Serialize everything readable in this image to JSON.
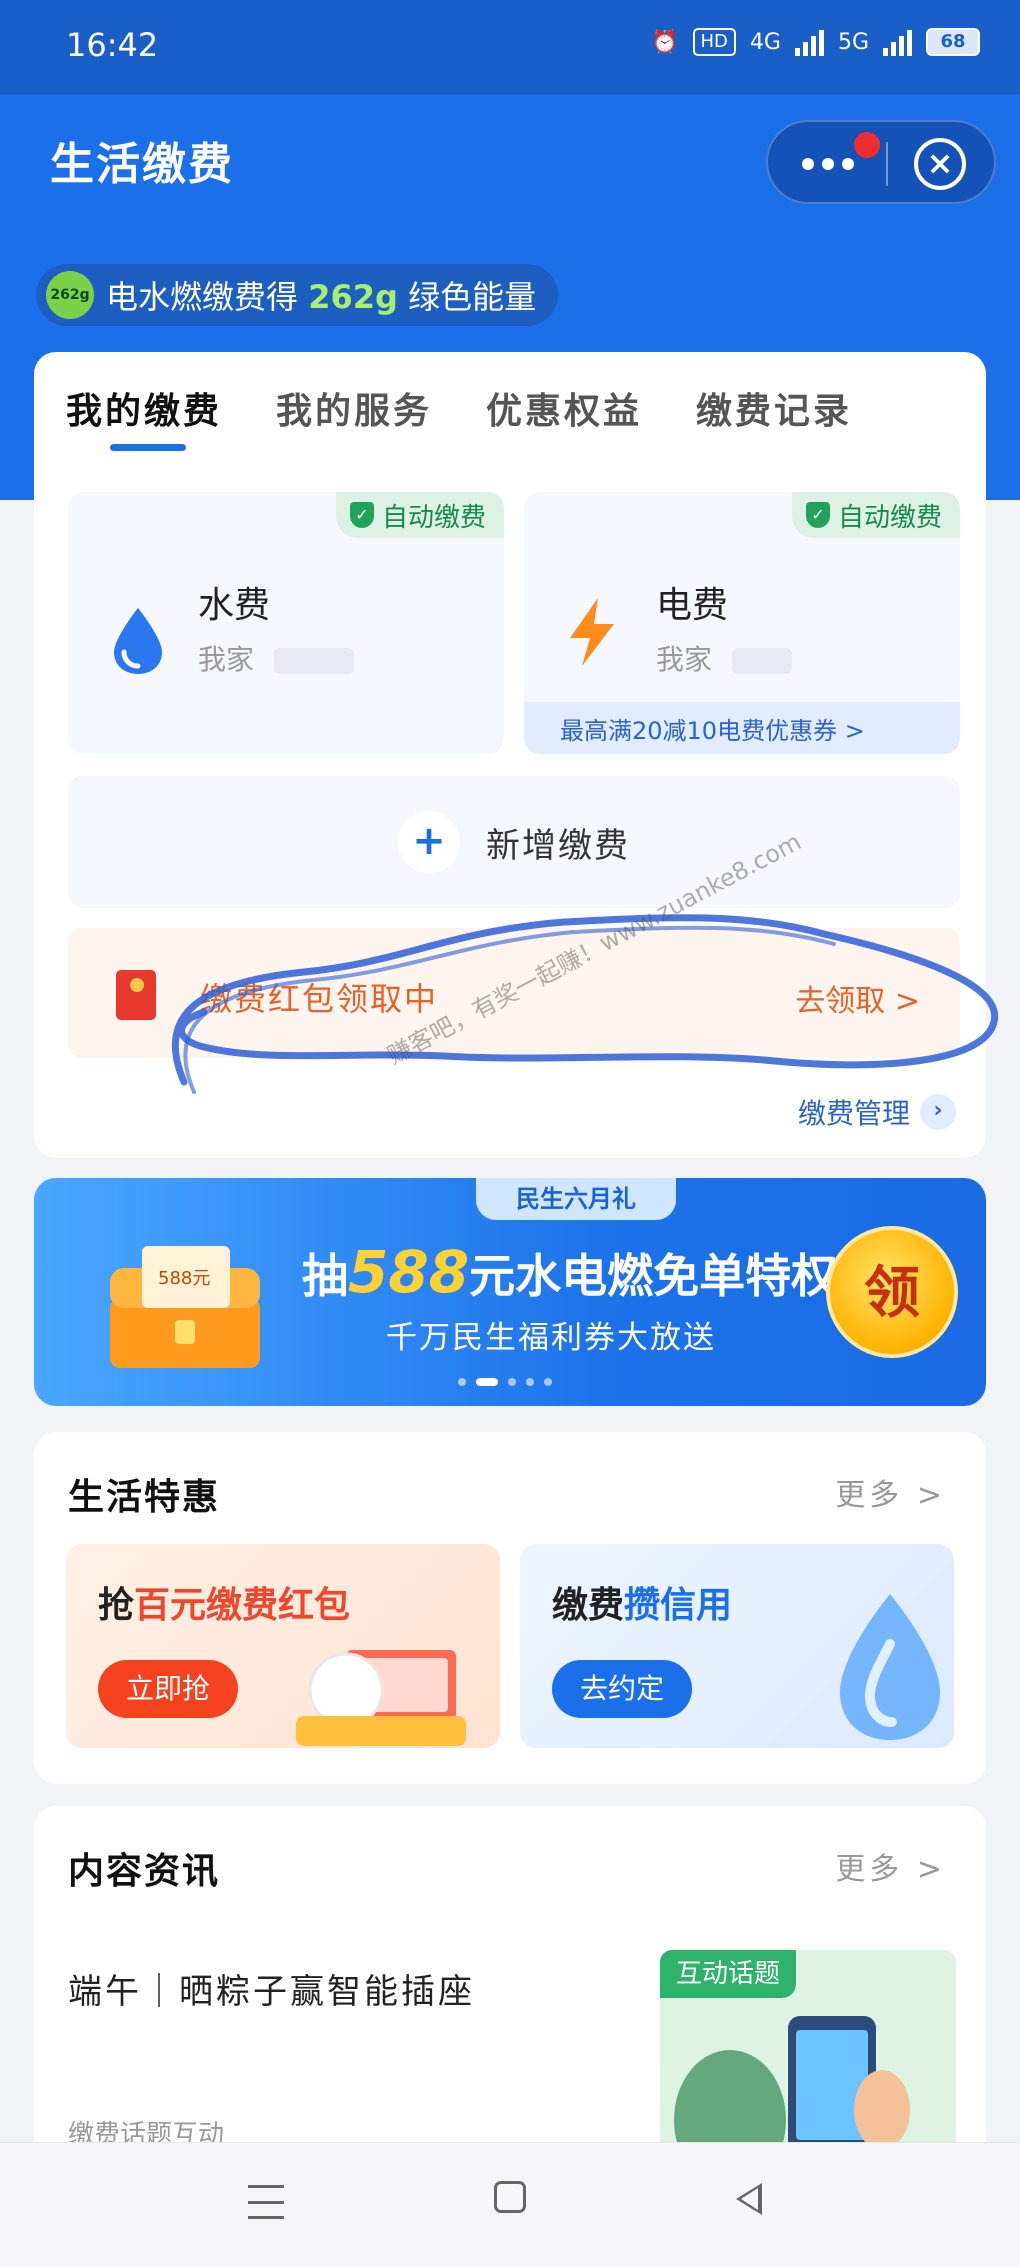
{
  "status_bar": {
    "time": "16:42",
    "hd": "HD",
    "net1": "4G",
    "net2": "5G",
    "battery": "68"
  },
  "header": {
    "title": "生活缴费",
    "menu_icon": "more-dots-icon",
    "close_icon": "close-circle-icon"
  },
  "energy": {
    "badge": "262g",
    "text_prefix": "电水燃缴费得",
    "amount": "262g",
    "text_suffix": "绿色能量"
  },
  "tabs": [
    {
      "label": "我的缴费",
      "active": true
    },
    {
      "label": "我的服务",
      "active": false
    },
    {
      "label": "优惠权益",
      "active": false
    },
    {
      "label": "缴费记录",
      "active": false
    }
  ],
  "bills": [
    {
      "name": "水费",
      "account": "我家",
      "auto_label": "自动缴费",
      "icon": "water-drop-icon"
    },
    {
      "name": "电费",
      "account": "我家",
      "auto_label": "自动缴费",
      "icon": "lightning-icon",
      "coupon": "最高满20减10电费优惠券 >"
    }
  ],
  "add_bill": {
    "label": "新增缴费",
    "icon": "plus-icon"
  },
  "red_packet": {
    "text": "缴费红包领取中",
    "action": "去领取 >"
  },
  "manage": {
    "label": "缴费管理"
  },
  "watermark": "赚客吧，有奖一起赚！www.zuanke8.com",
  "banner": {
    "tag": "民生六月礼",
    "title_pre": "抽",
    "title_amount": "588",
    "title_post": "元水电燃免单特权",
    "subtitle": "千万民生福利券大放送",
    "coin_label": "领",
    "chest_label": "588元"
  },
  "deals": {
    "title": "生活特惠",
    "more": "更多 >",
    "items": [
      {
        "title_pre": "抢",
        "title_hl": "百元缴费红包",
        "button": "立即抢"
      },
      {
        "title_pre": "缴费",
        "title_hl": "攒信用",
        "button": "去约定"
      }
    ]
  },
  "news": {
    "title": "内容资讯",
    "more": "更多 >",
    "headline": "端午｜晒粽子赢智能插座",
    "source": "缴费话题互动",
    "thumb_tag": "互动话题"
  },
  "colors": {
    "brand_blue": "#1b6fe8",
    "accent_red": "#f0462c",
    "energy_green": "#a6f06b"
  }
}
